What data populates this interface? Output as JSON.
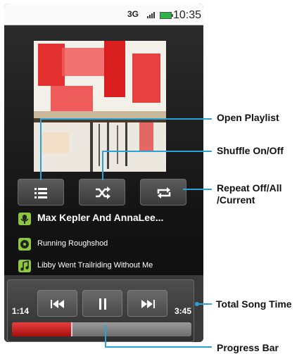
{
  "status_bar": {
    "network": "3G",
    "time": "10:35"
  },
  "controls": {
    "playlist_icon": "list-icon",
    "shuffle_icon": "shuffle-icon",
    "repeat_icon": "repeat-icon"
  },
  "track": {
    "artist": "Max Kepler And AnnaLee...",
    "album": "Running Roughshod",
    "song": "Libby Went Trailriding Without  Me"
  },
  "transport": {
    "elapsed": "1:14",
    "total": "3:45",
    "progress": 0.33
  },
  "callouts": {
    "open_playlist": "Open Playlist",
    "shuffle": "Shuffle On/Off",
    "repeat_line1": "Repeat Off/All",
    "repeat_line2": "/Current",
    "total_song_time": "Total Song Time",
    "progress_bar": "Progress Bar"
  },
  "colors": {
    "accent": "#2aa4d8",
    "progress": "#c81e1e",
    "track_icon": "#8dc63f"
  }
}
